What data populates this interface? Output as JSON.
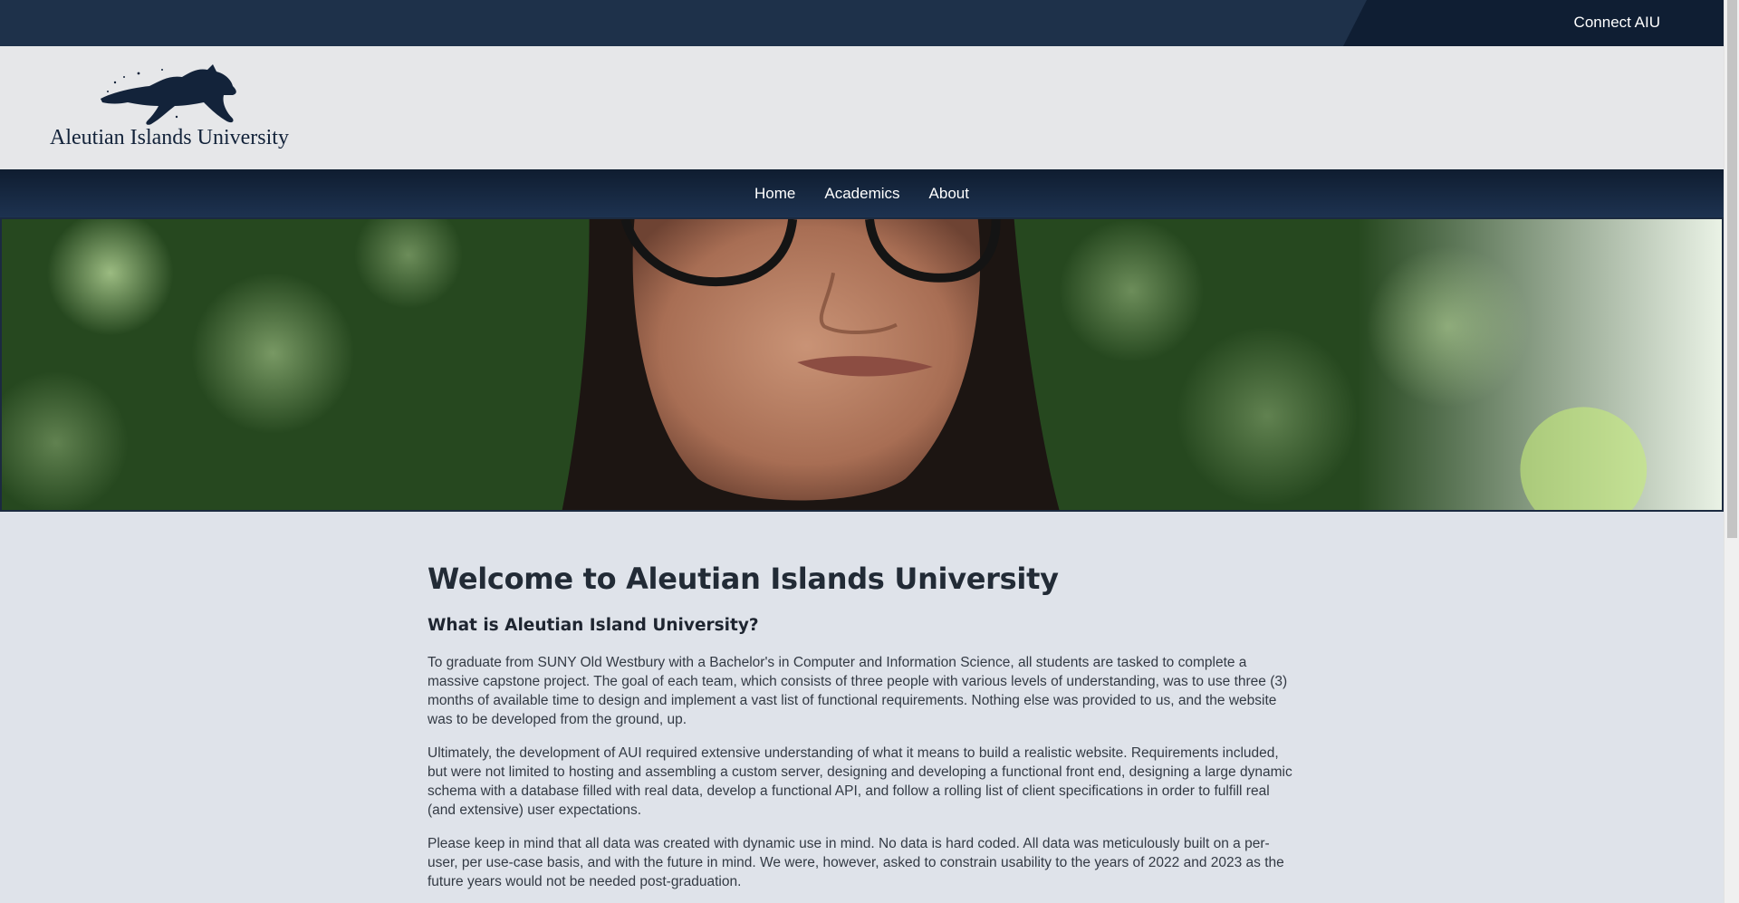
{
  "topbar": {
    "connect_label": "Connect AIU"
  },
  "header": {
    "logo_text": "Aleutian Islands University",
    "logo_icon": "wolf-icon"
  },
  "nav": {
    "items": [
      {
        "label": "Home"
      },
      {
        "label": "Academics"
      },
      {
        "label": "About"
      }
    ]
  },
  "hero": {
    "image": "student-portrait-photo"
  },
  "main": {
    "title": "Welcome to Aleutian Islands University",
    "subtitle": "What is Aleutian Island University?",
    "paragraphs": [
      "To graduate from SUNY Old Westbury with a Bachelor's in Computer and Information Science, all students are tasked to complete a massive capstone project. The goal of each team, which consists of three people with various levels of understanding, was to use three (3) months of available time to design and implement a vast list of functional requirements. Nothing else was provided to us, and the website was to be developed from the ground, up.",
      "Ultimately, the development of AUI required extensive understanding of what it means to build a realistic website. Requirements included, but were not limited to hosting and assembling a custom server, designing and developing a functional front end, designing a large dynamic schema with a database filled with real data, develop a functional API, and follow a rolling list of client specifications in order to fulfill real (and extensive) user expectations.",
      "Please keep in mind that all data was created with dynamic use in mind. No data is hard coded. All data was meticulously built on a per-user, per use-case basis, and with the future in mind. We were, however, asked to constrain usability to the years of 2022 and 2023 as the future years would not be needed post-graduation."
    ]
  },
  "colors": {
    "topbar": "#1e314a",
    "nav": "#1d3250",
    "header": "#e6e7e9",
    "page": "#dfe3ea"
  }
}
